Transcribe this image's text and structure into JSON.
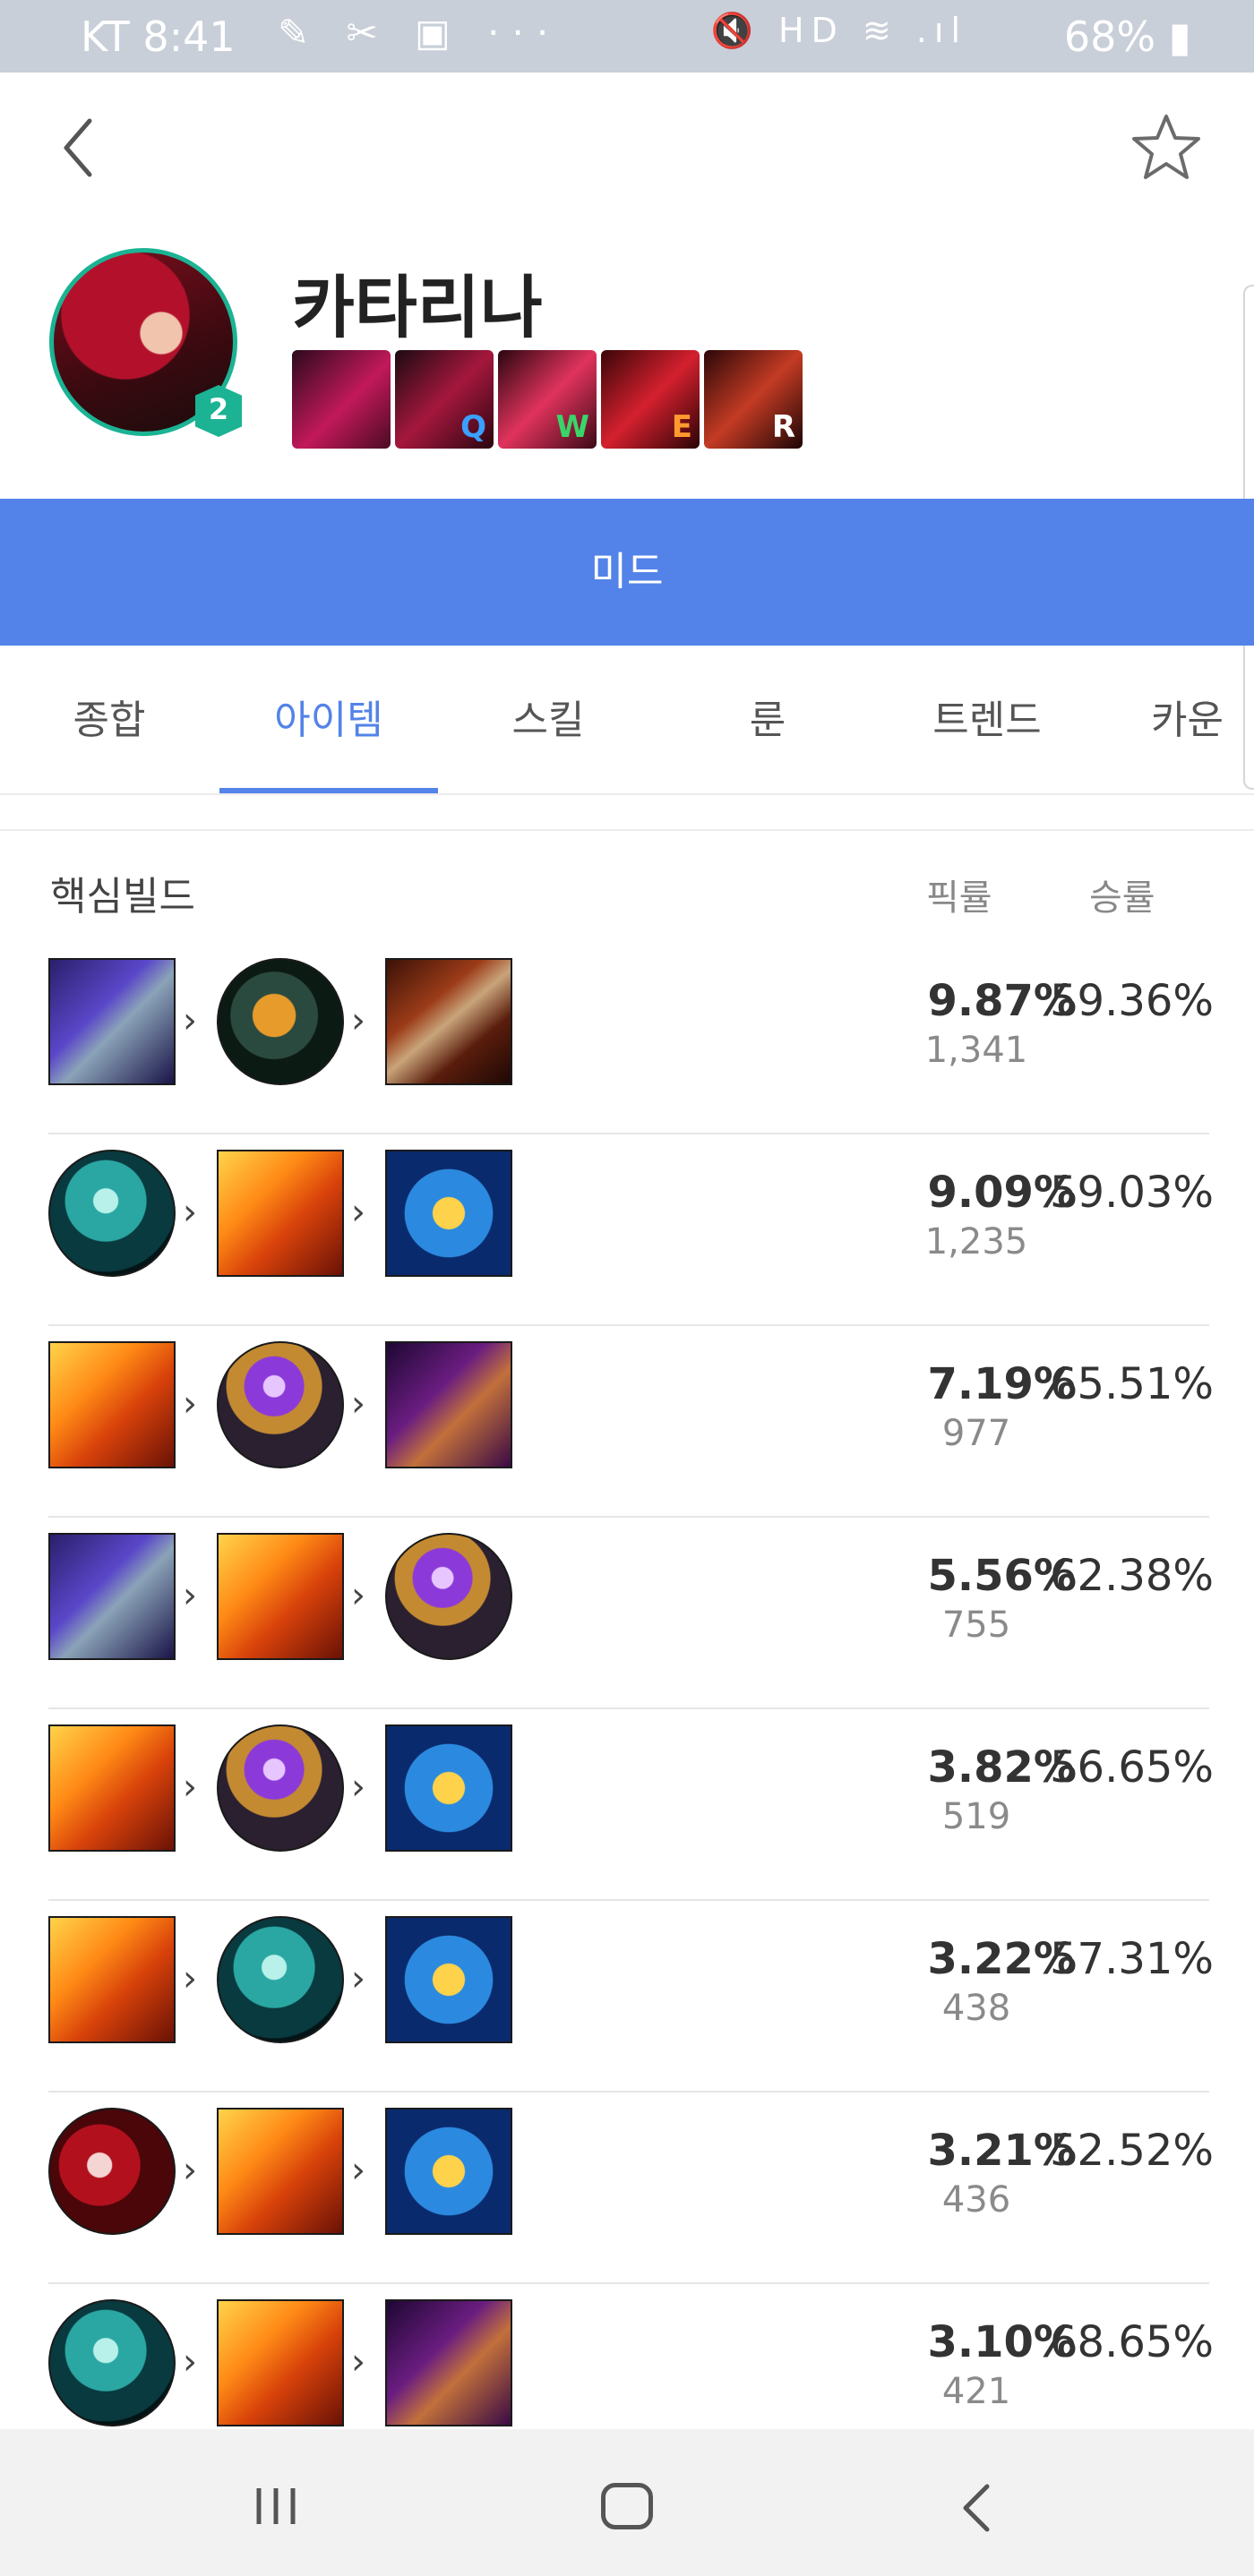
{
  "status_bar": {
    "time": "KT 8:41",
    "notification_icons": "✎ ✂ ▣ ···",
    "system_icons": "🔇 HD ≋ .ıl",
    "battery": "68%"
  },
  "header": {
    "back_icon": "chevron-left-icon",
    "favorite_icon": "star-outline-icon"
  },
  "champion": {
    "name": "카타리나",
    "avatar_badge": "2",
    "skills": [
      {
        "key": "",
        "label": "passive"
      },
      {
        "key": "Q",
        "key_color": "#3aa0ff"
      },
      {
        "key": "W",
        "key_color": "#39d56a"
      },
      {
        "key": "E",
        "key_color": "#ff9a2e"
      },
      {
        "key": "R",
        "key_color": "#ffffff"
      }
    ]
  },
  "lane": {
    "label": "미드"
  },
  "tabs": [
    {
      "label": "종합"
    },
    {
      "label": "아이템",
      "active": true
    },
    {
      "label": "스킬"
    },
    {
      "label": "룬"
    },
    {
      "label": "트렌드"
    },
    {
      "label": "카운터"
    }
  ],
  "core_build": {
    "title": "핵심빌드",
    "col_pick": "픽률",
    "col_win": "승률",
    "rows": [
      {
        "items": [
          "purple-sword",
          "dark-orb",
          "gold-blade"
        ],
        "pick": "9.87%",
        "count": "1,341",
        "win": "59.36%"
      },
      {
        "items": [
          "teal-helm",
          "fire-sword",
          "hourglass"
        ],
        "pick": "9.09%",
        "count": "1,235",
        "win": "59.03%"
      },
      {
        "items": [
          "fire-sword",
          "void-orb",
          "purple-wing"
        ],
        "pick": "7.19%",
        "count": "977",
        "win": "65.51%"
      },
      {
        "items": [
          "purple-sword",
          "fire-sword",
          "void-orb"
        ],
        "pick": "5.56%",
        "count": "755",
        "win": "62.38%"
      },
      {
        "items": [
          "fire-sword",
          "void-orb",
          "hourglass"
        ],
        "pick": "3.82%",
        "count": "519",
        "win": "56.65%"
      },
      {
        "items": [
          "fire-sword",
          "teal-helm",
          "hourglass"
        ],
        "pick": "3.22%",
        "count": "438",
        "win": "57.31%"
      },
      {
        "items": [
          "red-scythe",
          "fire-sword",
          "hourglass"
        ],
        "pick": "3.21%",
        "count": "436",
        "win": "52.52%"
      },
      {
        "items": [
          "teal-helm",
          "fire-sword",
          "purple-wing"
        ],
        "pick": "3.10%",
        "count": "421",
        "win": "68.65%"
      }
    ]
  },
  "colors": {
    "accent": "#5383e8",
    "badge": "#1bb394"
  }
}
